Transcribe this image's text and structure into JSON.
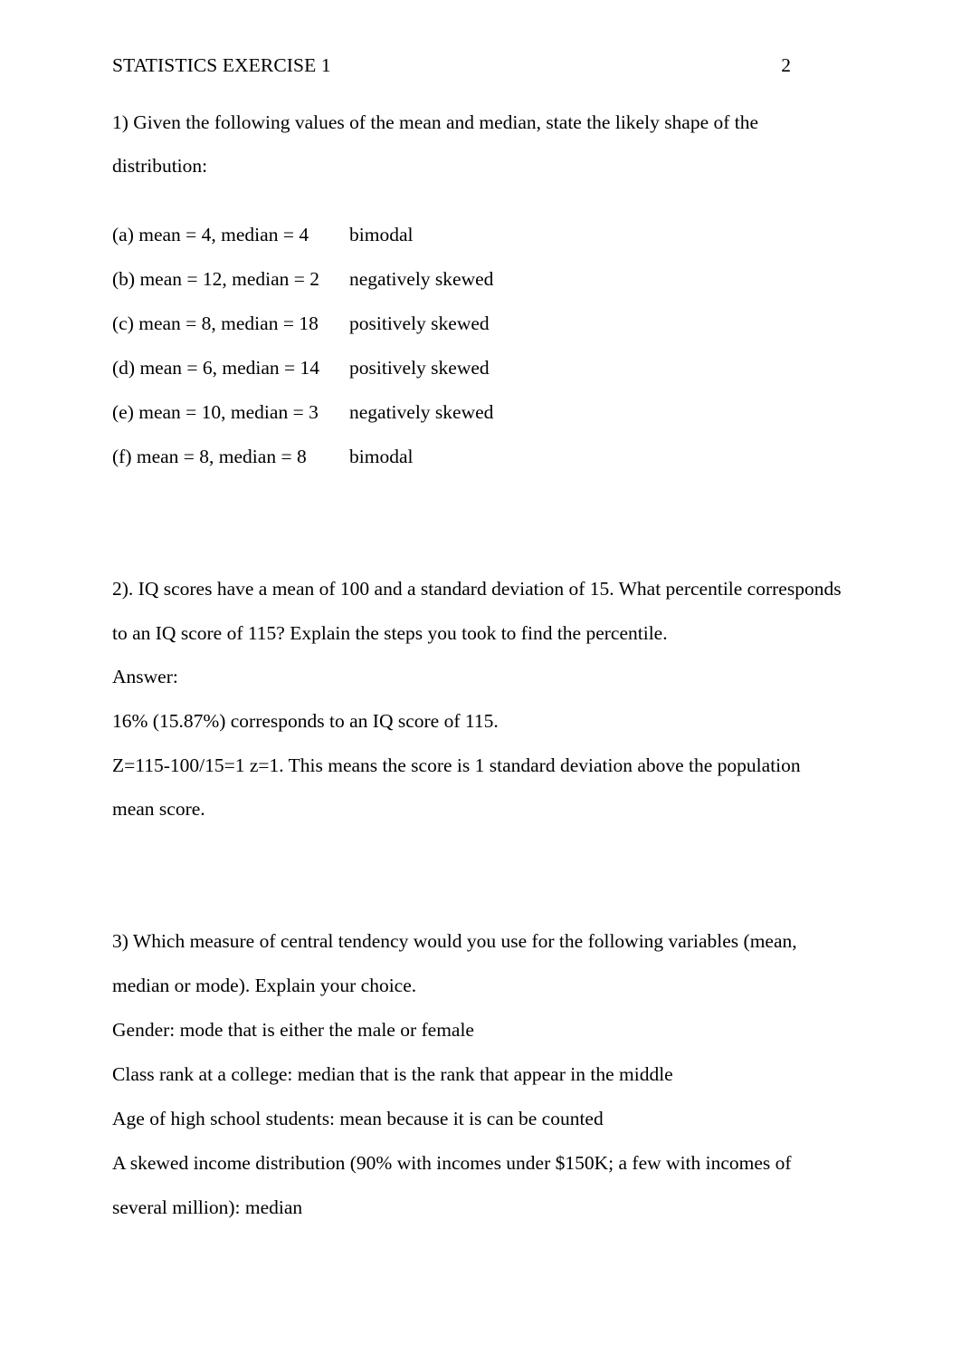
{
  "header": {
    "title": "STATISTICS EXERCISE 1",
    "page_number": "2"
  },
  "questions": {
    "q1": {
      "prompt_line_1": "1) Given the following values of the mean and median, state the likely shape of the",
      "prompt_line_2": "distribution:",
      "items": [
        {
          "label": "(a) mean = 4, median = 4",
          "answer": "bimodal"
        },
        {
          "label": "(b) mean = 12, median = 2",
          "answer": "negatively skewed"
        },
        {
          "label": "(c) mean = 8, median = 18",
          "answer": "positively skewed"
        },
        {
          "label": "(d) mean = 6, median = 14",
          "answer": "positively skewed"
        },
        {
          "label": "(e) mean = 10, median = 3",
          "answer": "negatively skewed"
        },
        {
          "label": "(f) mean = 8, median = 8",
          "answer": "bimodal"
        }
      ]
    },
    "q2": {
      "prompt_line_1": "2). IQ scores have a mean of 100 and a standard deviation of 15. What percentile corresponds",
      "prompt_line_2": "to an IQ score of 115? Explain the steps you took to find the percentile.",
      "answer_label": "Answer:",
      "answer_line_1": "16% (15.87%) corresponds to an IQ score of 115.",
      "answer_line_2": "Z=115-100/15=1 z=1. This means the score is 1 standard deviation above the population",
      "answer_line_3": "mean score."
    },
    "q3": {
      "prompt_line_1": "3) Which measure of central tendency would you use for the following variables (mean,",
      "prompt_line_2": "median or mode). Explain your choice.",
      "answers": [
        "Gender: mode that is either the male or female",
        "Class rank at a college: median that is the rank that appear in the middle",
        "Age of high school students: mean because it is can be counted",
        "A skewed income distribution (90% with incomes under $150K; a few with incomes of",
        "several million): median"
      ]
    }
  }
}
